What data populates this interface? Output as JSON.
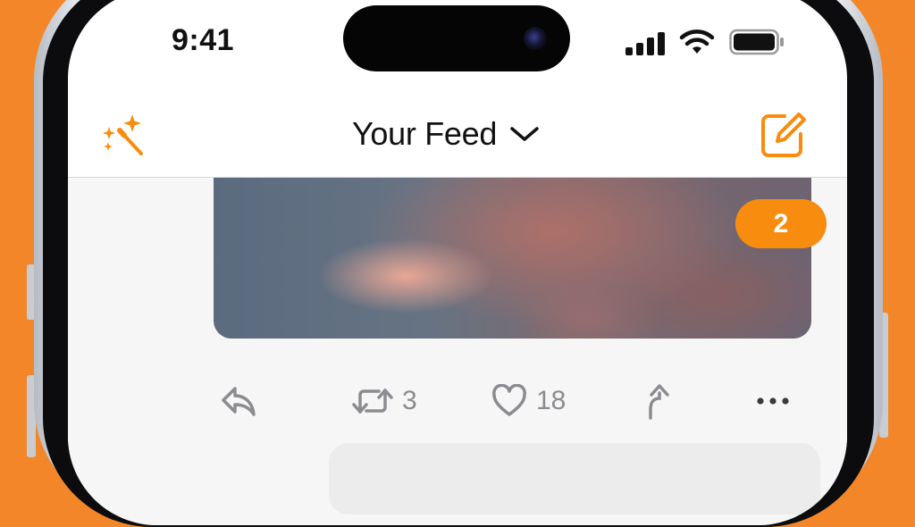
{
  "status_bar": {
    "time": "9:41",
    "icons": [
      "cellular-signal-icon",
      "wifi-icon",
      "battery-icon"
    ]
  },
  "nav": {
    "left_icon": "magic-wand-icon",
    "title": "Your Feed",
    "title_icon": "chevron-down-icon",
    "right_icon": "compose-icon"
  },
  "post": {
    "new_posts_badge": "2",
    "actions": {
      "reply_icon": "reply-icon",
      "repost_icon": "repost-icon",
      "repost_count": "3",
      "like_icon": "heart-icon",
      "like_count": "18",
      "share_icon": "share-icon",
      "more_icon": "more-icon"
    }
  },
  "colors": {
    "accent": "#f78c0e",
    "background": "#f4862a",
    "icon_gray": "#8b8b90"
  }
}
